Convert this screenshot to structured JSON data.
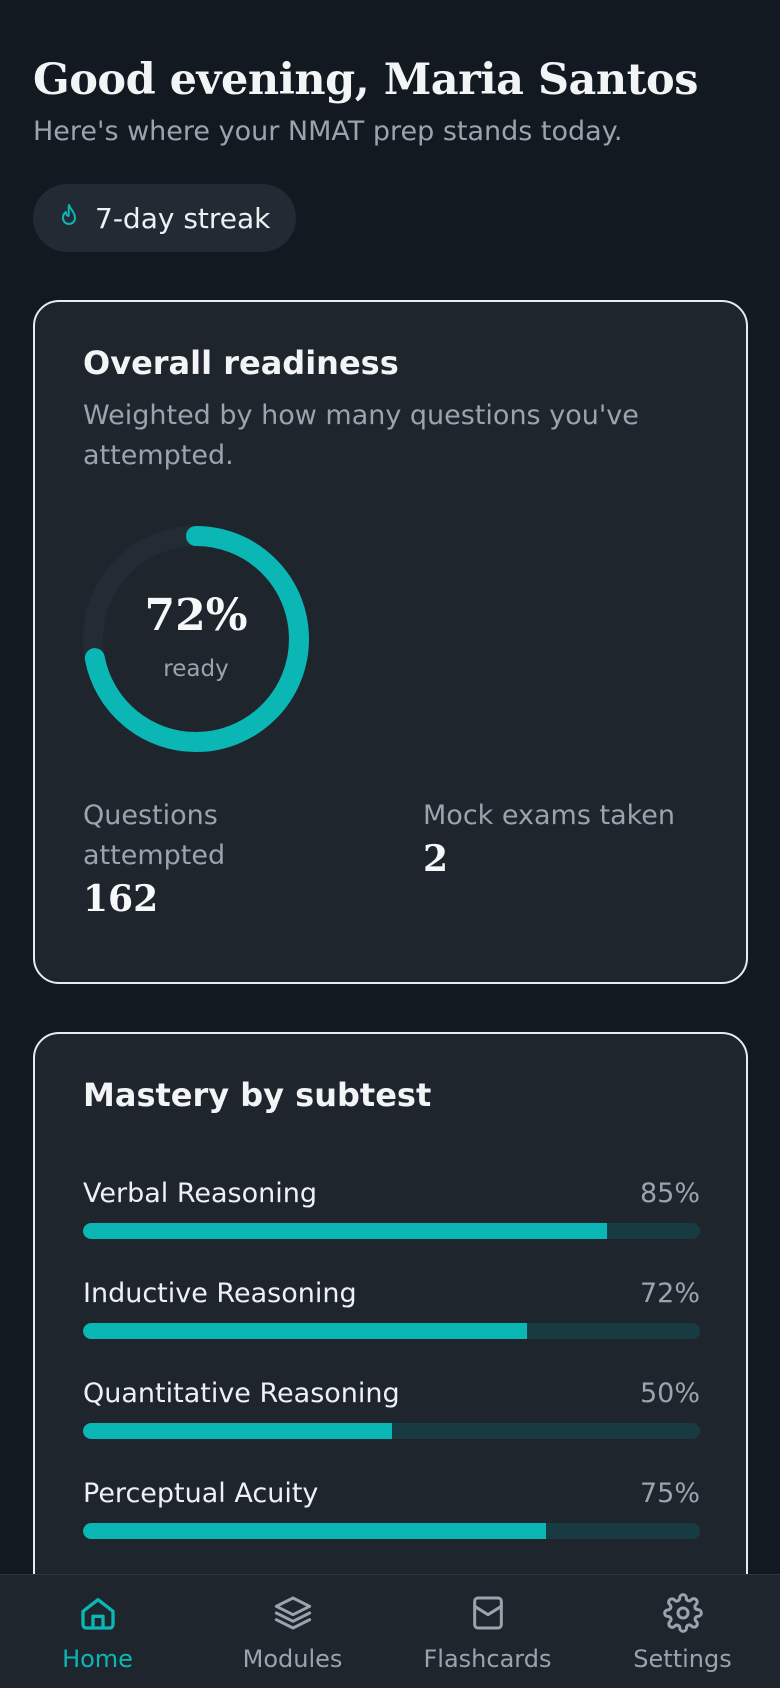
{
  "header": {
    "greeting": "Good evening, Maria Santos",
    "subtitle": "Here's where your NMAT prep stands today."
  },
  "streak": {
    "label": "7-day streak",
    "icon": "flame-icon"
  },
  "readiness": {
    "title": "Overall readiness",
    "description": "Weighted by how many questions you've attempted.",
    "percent": 72,
    "percent_label": "72%",
    "ring_caption": "ready",
    "stats": [
      {
        "label": "Questions attempted",
        "value": "162"
      },
      {
        "label": "Mock exams taken",
        "value": "2"
      }
    ]
  },
  "mastery": {
    "title": "Mastery by subtest",
    "subtests": [
      {
        "name": "Verbal Reasoning",
        "percent": 85,
        "percent_label": "85%"
      },
      {
        "name": "Inductive Reasoning",
        "percent": 72,
        "percent_label": "72%"
      },
      {
        "name": "Quantitative Reasoning",
        "percent": 50,
        "percent_label": "50%"
      },
      {
        "name": "Perceptual Acuity",
        "percent": 75,
        "percent_label": "75%"
      }
    ]
  },
  "tabbar": {
    "items": [
      {
        "label": "Home",
        "icon": "home-icon",
        "active": true
      },
      {
        "label": "Modules",
        "icon": "layers-icon",
        "active": false
      },
      {
        "label": "Flashcards",
        "icon": "card-box-icon",
        "active": false
      },
      {
        "label": "Settings",
        "icon": "gear-icon",
        "active": false
      }
    ]
  },
  "colors": {
    "background": "#121920",
    "card": "#1e252d",
    "accent": "#0ab7b5",
    "track": "#173b40",
    "muted_text": "#9aa4ad"
  }
}
